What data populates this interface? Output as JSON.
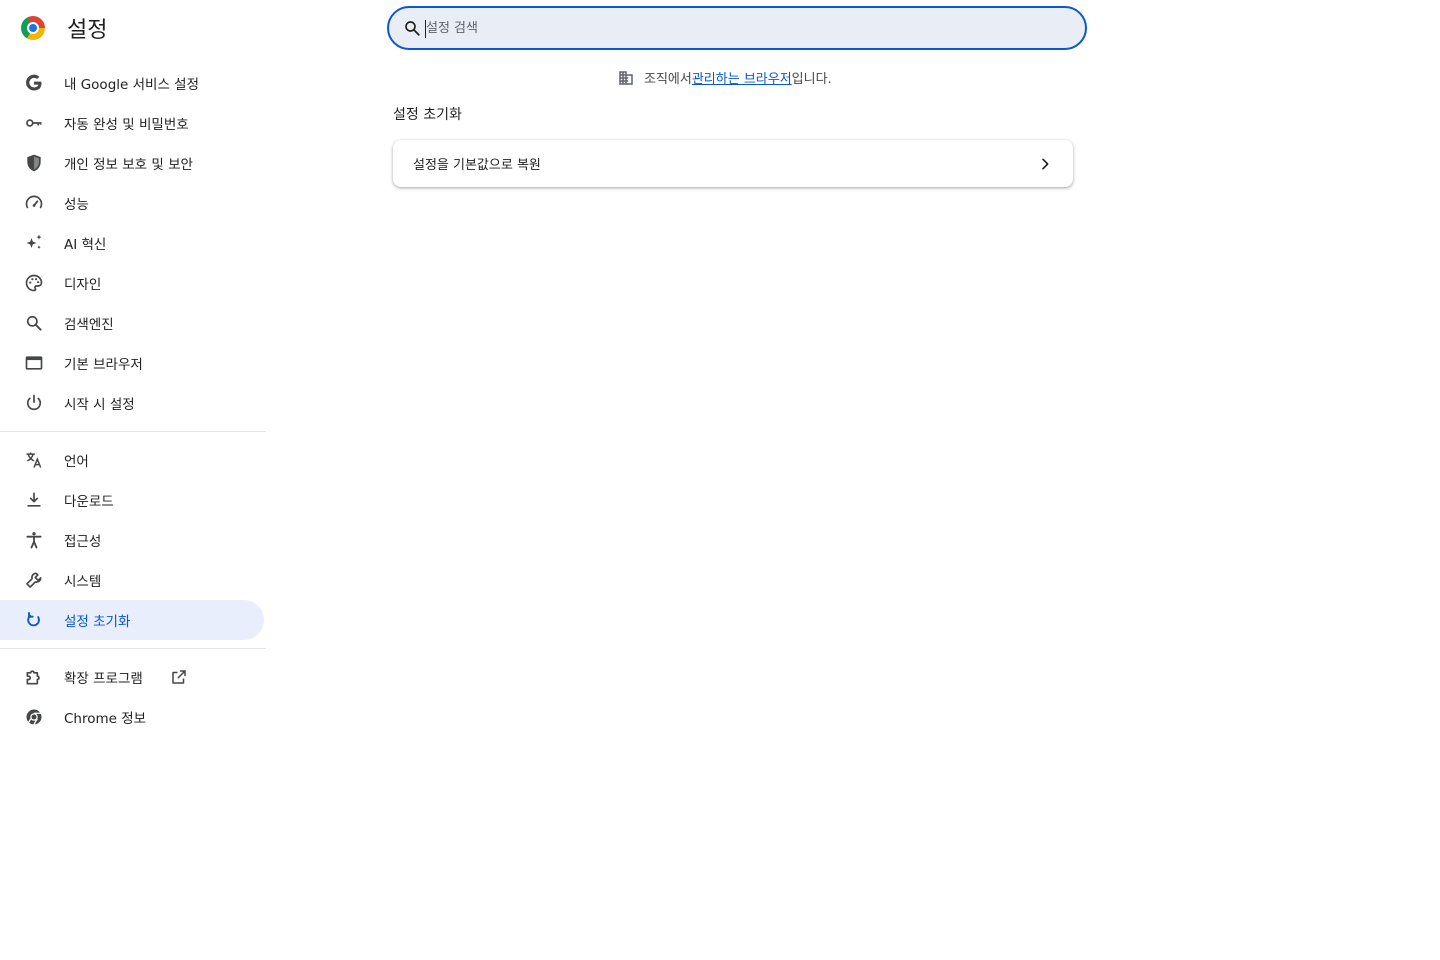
{
  "header": {
    "title": "설정",
    "search_placeholder": "설정 검색"
  },
  "sidebar": {
    "group1": [
      {
        "label": "내 Google 서비스 설정",
        "icon": "google-icon"
      },
      {
        "label": "자동 완성 및 비밀번호",
        "icon": "key-icon"
      },
      {
        "label": "개인 정보 보호 및 보안",
        "icon": "shield-icon"
      },
      {
        "label": "성능",
        "icon": "speedometer-icon"
      },
      {
        "label": "AI 혁신",
        "icon": "sparkle-icon"
      },
      {
        "label": "디자인",
        "icon": "palette-icon"
      },
      {
        "label": "검색엔진",
        "icon": "search-icon"
      },
      {
        "label": "기본 브라우저",
        "icon": "browser-window-icon"
      },
      {
        "label": "시작 시 설정",
        "icon": "power-icon"
      }
    ],
    "group2": [
      {
        "label": "언어",
        "icon": "translate-icon"
      },
      {
        "label": "다운로드",
        "icon": "download-icon"
      },
      {
        "label": "접근성",
        "icon": "accessibility-icon"
      },
      {
        "label": "시스템",
        "icon": "wrench-icon"
      },
      {
        "label": "설정 초기화",
        "icon": "reset-icon",
        "active": true
      }
    ],
    "group3": [
      {
        "label": "확장 프로그램",
        "icon": "puzzle-icon",
        "external": true
      },
      {
        "label": "Chrome 정보",
        "icon": "chrome-icon"
      }
    ]
  },
  "managed_notice": {
    "prefix": "조직에서 ",
    "link": "관리하는 브라우저",
    "suffix": "입니다."
  },
  "main": {
    "section_title": "설정 초기화",
    "card_label": "설정을 기본값으로 복원"
  },
  "colors": {
    "accent": "#0b57d0",
    "active_bg": "#e8eefb",
    "search_bg": "#e9eef6"
  }
}
